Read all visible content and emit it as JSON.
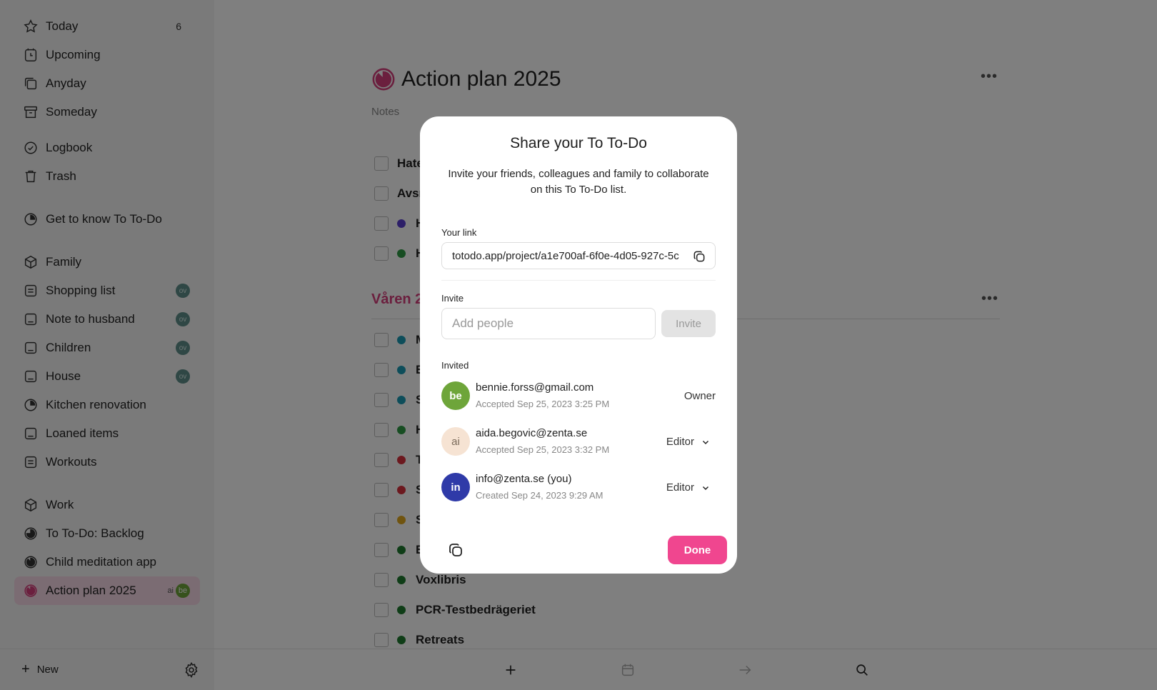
{
  "sidebar": {
    "items": [
      {
        "label": "Today",
        "icon": "star-icon",
        "count": "6"
      },
      {
        "label": "Upcoming",
        "icon": "clock-icon"
      },
      {
        "label": "Anyday",
        "icon": "layers-icon"
      },
      {
        "label": "Someday",
        "icon": "archive-box-icon"
      },
      {
        "label": "Logbook",
        "icon": "logbook-check-icon"
      },
      {
        "label": "Trash",
        "icon": "trash-icon"
      },
      {
        "label": "Get to know To To-Do",
        "icon": "pie-progress-icon"
      },
      {
        "label": "Family",
        "icon": "cube-icon"
      },
      {
        "label": "Shopping list",
        "icon": "list-icon",
        "badge": "ov"
      },
      {
        "label": "Note to husband",
        "icon": "list-icon",
        "badge": "ov"
      },
      {
        "label": "Children",
        "icon": "list-icon",
        "badge": "ov"
      },
      {
        "label": "House",
        "icon": "list-icon",
        "badge": "ov"
      },
      {
        "label": "Kitchen renovation",
        "icon": "pie-progress-icon"
      },
      {
        "label": "Loaned items",
        "icon": "list-icon"
      },
      {
        "label": "Workouts",
        "icon": "list-icon"
      },
      {
        "label": "Work",
        "icon": "cube-icon"
      },
      {
        "label": "To To-Do: Backlog",
        "icon": "pie-progress-icon"
      },
      {
        "label": "Child meditation app",
        "icon": "pie-progress-icon"
      },
      {
        "label": "Action plan 2025",
        "icon": "pie-progress-icon",
        "badge_ai": "ai",
        "badge_be": "be"
      }
    ],
    "new_label": "New"
  },
  "main": {
    "title": "Action plan 2025",
    "notes": "Notes",
    "tasks_top": [
      {
        "text": "Hate",
        "color": ""
      },
      {
        "text": "Avsn",
        "color": ""
      },
      {
        "text": "H",
        "color": "#5b3fd1"
      },
      {
        "text": "H",
        "color": "#2e9b45"
      }
    ],
    "section": "Våren 2",
    "tasks": [
      {
        "text": "M",
        "color": "#1a9ab5"
      },
      {
        "text": "E",
        "color": "#1a9ab5"
      },
      {
        "text": "S",
        "color": "#1a9ab5"
      },
      {
        "text": "H",
        "color": "#2e9b45"
      },
      {
        "text": "T",
        "color": "#d8313c"
      },
      {
        "text": "S",
        "color": "#d8313c"
      },
      {
        "text": "S",
        "color": "#e0a81f"
      },
      {
        "text": "E",
        "color": "#1e7a2e"
      },
      {
        "text": "Voxlibris",
        "color": "#1e7a2e"
      },
      {
        "text": "PCR-Testbedrägeriet",
        "color": "#1e7a2e"
      },
      {
        "text": "Retreats",
        "color": "#1e7a2e"
      }
    ]
  },
  "modal": {
    "title": "Share your To To-Do",
    "description": "Invite your friends, colleagues and family to collaborate on this To To-Do list.",
    "link_label": "Your link",
    "link_value": "totodo.app/project/a1e700af-6f0e-4d05-927c-5c",
    "invite_label": "Invite",
    "invite_placeholder": "Add people",
    "invite_button": "Invite",
    "invited_label": "Invited",
    "people": [
      {
        "initials": "be",
        "email": "bennie.forss@gmail.com",
        "status": "Accepted Sep 25, 2023 3:25 PM",
        "role": "Owner",
        "avatar_bg": "#6ea53a",
        "avatar_fg": "#ffffff"
      },
      {
        "initials": "ai",
        "email": "aida.begovic@zenta.se",
        "status": "Accepted Sep 25, 2023 3:32 PM",
        "role": "Editor",
        "avatar_bg": "#f6e3d3",
        "avatar_fg": "#7a6a5a"
      },
      {
        "initials": "in",
        "email": "info@zenta.se (you)",
        "status": "Created Sep 24, 2023 9:29 AM",
        "role": "Editor",
        "avatar_bg": "#2f3aa8",
        "avatar_fg": "#ffffff"
      }
    ],
    "done_button": "Done"
  },
  "colors": {
    "accent": "#f0468f",
    "section": "#d63e7c",
    "active_bg": "#f7d9e7"
  }
}
